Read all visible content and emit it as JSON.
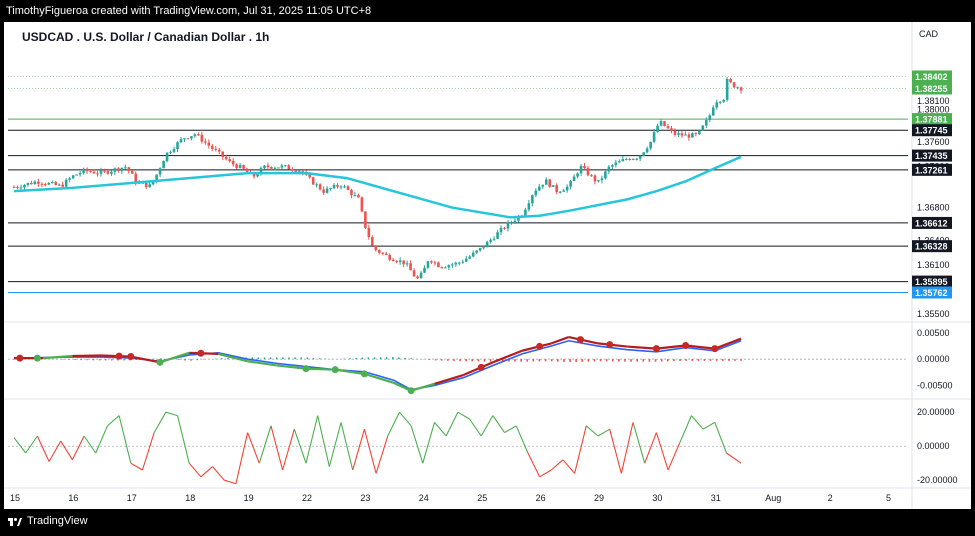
{
  "header": {
    "attribution": "TimothyFigueroa created with TradingView.com, Jul 31, 2025 11:05 UTC+8"
  },
  "footer": {
    "brand": "TradingView"
  },
  "chart_data": [
    {
      "type": "candlestick",
      "title": "USDCAD . U.S. Dollar / Canadian Dollar . 1h",
      "currency": "CAD",
      "ylim": [
        1.3545,
        1.3875
      ],
      "x_tick_labels": [
        "15",
        "16",
        "17",
        "18",
        "19",
        "22",
        "23",
        "24",
        "25",
        "26",
        "29",
        "30",
        "31",
        "Aug",
        "2",
        "5"
      ],
      "y_tick_labels": [
        "1.38100",
        "1.38000",
        "1.37600",
        "1.37300",
        "1.36800",
        "1.36400",
        "1.36100",
        "1.35500"
      ],
      "horizontal_levels": [
        {
          "value": "1.38402",
          "color": "#81c784",
          "label_bg": "#4caf50"
        },
        {
          "value": "1.38255",
          "color": "#81c784",
          "label_bg": "#4caf50"
        },
        {
          "value": "1.37881",
          "color": "#4caf50",
          "label_bg": "#4caf50"
        },
        {
          "value": "1.37745",
          "color": "#131722",
          "label_bg": "#131722"
        },
        {
          "value": "1.37435",
          "color": "#131722",
          "label_bg": "#131722"
        },
        {
          "value": "1.37261",
          "color": "#131722",
          "label_bg": "#131722"
        },
        {
          "value": "1.36612",
          "color": "#131722",
          "label_bg": "#131722"
        },
        {
          "value": "1.36328",
          "color": "#131722",
          "label_bg": "#131722"
        },
        {
          "value": "1.35895",
          "color": "#131722",
          "label_bg": "#131722"
        },
        {
          "value": "1.35762",
          "color": "#2196f3",
          "label_bg": "#2196f3"
        }
      ],
      "close_path": [
        [
          0,
          1.3705
        ],
        [
          0.4,
          1.3712
        ],
        [
          0.8,
          1.3706
        ],
        [
          1.0,
          1.3718
        ],
        [
          1.2,
          1.3725
        ],
        [
          1.5,
          1.3722
        ],
        [
          1.9,
          1.373
        ],
        [
          2.0,
          1.3722
        ],
        [
          2.1,
          1.371
        ],
        [
          2.35,
          1.3706
        ],
        [
          2.6,
          1.3745
        ],
        [
          2.9,
          1.3765
        ],
        [
          3.1,
          1.377
        ],
        [
          3.4,
          1.3752
        ],
        [
          3.7,
          1.3735
        ],
        [
          3.9,
          1.3728
        ],
        [
          4.1,
          1.3718
        ],
        [
          4.3,
          1.373
        ],
        [
          4.6,
          1.373
        ],
        [
          4.9,
          1.3725
        ],
        [
          5.0,
          1.3718
        ],
        [
          5.3,
          1.37
        ],
        [
          5.6,
          1.3708
        ],
        [
          5.9,
          1.369
        ],
        [
          6.0,
          1.366
        ],
        [
          6.15,
          1.363
        ],
        [
          6.4,
          1.362
        ],
        [
          6.7,
          1.3612
        ],
        [
          6.9,
          1.3592
        ],
        [
          7.0,
          1.36
        ],
        [
          7.1,
          1.3618
        ],
        [
          7.3,
          1.3608
        ],
        [
          7.6,
          1.3612
        ],
        [
          7.8,
          1.362
        ],
        [
          8.0,
          1.363
        ],
        [
          8.3,
          1.365
        ],
        [
          8.5,
          1.3662
        ],
        [
          8.7,
          1.3672
        ],
        [
          8.9,
          1.37
        ],
        [
          9.1,
          1.3713
        ],
        [
          9.3,
          1.37
        ],
        [
          9.5,
          1.3706
        ],
        [
          9.7,
          1.373
        ],
        [
          9.85,
          1.372
        ],
        [
          10.0,
          1.371
        ],
        [
          10.2,
          1.373
        ],
        [
          10.5,
          1.374
        ],
        [
          10.7,
          1.3742
        ],
        [
          10.9,
          1.376
        ],
        [
          11.05,
          1.3785
        ],
        [
          11.3,
          1.377
        ],
        [
          11.5,
          1.3768
        ],
        [
          11.7,
          1.3768
        ],
        [
          11.9,
          1.379
        ],
        [
          12.0,
          1.381
        ],
        [
          12.2,
          1.3815
        ],
        [
          12.15,
          1.3838
        ],
        [
          12.3,
          1.383
        ],
        [
          12.45,
          1.3826
        ]
      ],
      "moving_average": {
        "color": "#26c6da",
        "points": [
          [
            0,
            1.37
          ],
          [
            1.0,
            1.3704
          ],
          [
            2.0,
            1.371
          ],
          [
            3.0,
            1.3716
          ],
          [
            4.0,
            1.3722
          ],
          [
            5.0,
            1.3722
          ],
          [
            5.7,
            1.3716
          ],
          [
            6.5,
            1.37
          ],
          [
            7.5,
            1.368
          ],
          [
            8.5,
            1.3668
          ],
          [
            9.0,
            1.367
          ],
          [
            9.5,
            1.3676
          ],
          [
            10.5,
            1.369
          ],
          [
            11.0,
            1.37
          ],
          [
            11.5,
            1.3712
          ],
          [
            12.0,
            1.3728
          ],
          [
            12.45,
            1.3742
          ]
        ]
      }
    },
    {
      "type": "line",
      "role": "macd",
      "ylim": [
        -0.0072,
        0.0065
      ],
      "y_tick_labels": [
        "0.00500",
        "0.00000",
        "-0.00500"
      ],
      "series": [
        {
          "color": "#2962ff",
          "values": [
            [
              0,
              0.0001
            ],
            [
              0.5,
              0.0003
            ],
            [
              1.0,
              0.0004
            ],
            [
              1.5,
              0.0004
            ],
            [
              2.0,
              0.0002
            ],
            [
              2.5,
              -0.0004
            ],
            [
              3.0,
              0.0008
            ],
            [
              3.5,
              0.0012
            ],
            [
              4.0,
              0.0
            ],
            [
              4.5,
              -0.0008
            ],
            [
              5.0,
              -0.0014
            ],
            [
              5.5,
              -0.002
            ],
            [
              6.0,
              -0.0024
            ],
            [
              6.5,
              -0.004
            ],
            [
              6.8,
              -0.0058
            ],
            [
              7.2,
              -0.005
            ],
            [
              7.7,
              -0.0035
            ],
            [
              8.2,
              -0.0012
            ],
            [
              8.7,
              0.001
            ],
            [
              9.2,
              0.0025
            ],
            [
              9.5,
              0.0035
            ],
            [
              10.0,
              0.0025
            ],
            [
              10.5,
              0.0018
            ],
            [
              11.0,
              0.0014
            ],
            [
              11.5,
              0.0022
            ],
            [
              12.0,
              0.0016
            ],
            [
              12.45,
              0.0035
            ]
          ]
        },
        {
          "color": "#4caf50",
          "negative_color": "#b71c1c",
          "values": [
            [
              0,
              0.0002
            ],
            [
              0.5,
              0.0002
            ],
            [
              1.0,
              0.0006
            ],
            [
              1.5,
              0.0007
            ],
            [
              2.0,
              0.0005
            ],
            [
              2.5,
              -0.0006
            ],
            [
              3.0,
              0.0012
            ],
            [
              3.5,
              0.001
            ],
            [
              4.0,
              -0.0004
            ],
            [
              4.5,
              -0.0012
            ],
            [
              5.0,
              -0.0018
            ],
            [
              5.5,
              -0.002
            ],
            [
              6.0,
              -0.0028
            ],
            [
              6.5,
              -0.0045
            ],
            [
              6.8,
              -0.006
            ],
            [
              7.2,
              -0.0047
            ],
            [
              7.7,
              -0.003
            ],
            [
              8.2,
              -0.0006
            ],
            [
              8.7,
              0.0016
            ],
            [
              9.2,
              0.003
            ],
            [
              9.5,
              0.0042
            ],
            [
              10.0,
              0.003
            ],
            [
              10.5,
              0.0024
            ],
            [
              11.0,
              0.002
            ],
            [
              11.5,
              0.0026
            ],
            [
              12.0,
              0.002
            ],
            [
              12.45,
              0.0039
            ]
          ]
        }
      ]
    },
    {
      "type": "line",
      "role": "oscillator",
      "ylim": [
        -24,
        26
      ],
      "y_tick_labels": [
        "20.00000",
        "0.00000",
        "-20.00000"
      ],
      "series": [
        {
          "color": "#4caf50",
          "negative_color": "#f44336",
          "values": [
            [
              0,
              5
            ],
            [
              0.2,
              -4
            ],
            [
              0.4,
              6
            ],
            [
              0.6,
              -9
            ],
            [
              0.8,
              3
            ],
            [
              1.0,
              -8
            ],
            [
              1.2,
              6
            ],
            [
              1.4,
              -4
            ],
            [
              1.6,
              12
            ],
            [
              1.8,
              18
            ],
            [
              2.0,
              -10
            ],
            [
              2.2,
              -14
            ],
            [
              2.4,
              8
            ],
            [
              2.6,
              20
            ],
            [
              2.8,
              18
            ],
            [
              3.0,
              -10
            ],
            [
              3.2,
              -18
            ],
            [
              3.4,
              -12
            ],
            [
              3.6,
              -20
            ],
            [
              3.8,
              -22
            ],
            [
              4.0,
              8
            ],
            [
              4.2,
              -10
            ],
            [
              4.4,
              12
            ],
            [
              4.6,
              -14
            ],
            [
              4.8,
              10
            ],
            [
              5.0,
              -10
            ],
            [
              5.2,
              18
            ],
            [
              5.4,
              -12
            ],
            [
              5.6,
              14
            ],
            [
              5.8,
              -14
            ],
            [
              6.0,
              10
            ],
            [
              6.2,
              -16
            ],
            [
              6.4,
              6
            ],
            [
              6.6,
              20
            ],
            [
              6.8,
              12
            ],
            [
              7.0,
              -10
            ],
            [
              7.2,
              14
            ],
            [
              7.4,
              6
            ],
            [
              7.6,
              20
            ],
            [
              7.8,
              16
            ],
            [
              8.0,
              6
            ],
            [
              8.2,
              18
            ],
            [
              8.4,
              8
            ],
            [
              8.6,
              12
            ],
            [
              8.8,
              -4
            ],
            [
              9.0,
              -18
            ],
            [
              9.2,
              -14
            ],
            [
              9.4,
              -8
            ],
            [
              9.6,
              -16
            ],
            [
              9.8,
              12
            ],
            [
              10.0,
              6
            ],
            [
              10.2,
              10
            ],
            [
              10.4,
              -16
            ],
            [
              10.6,
              14
            ],
            [
              10.8,
              -10
            ],
            [
              11.0,
              8
            ],
            [
              11.2,
              -14
            ],
            [
              11.4,
              2
            ],
            [
              11.6,
              18
            ],
            [
              11.8,
              10
            ],
            [
              12.0,
              14
            ],
            [
              12.2,
              -4
            ],
            [
              12.45,
              -10
            ]
          ]
        }
      ]
    }
  ]
}
